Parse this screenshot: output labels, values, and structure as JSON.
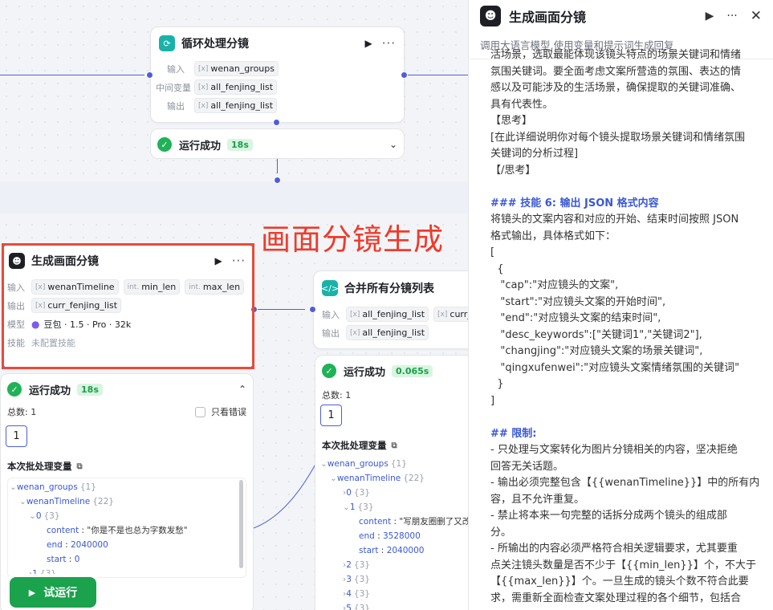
{
  "canvas": {
    "loop_node": {
      "title": "循环处理分镜",
      "rows": [
        {
          "label": "输入",
          "var": "wenan_groups"
        },
        {
          "label": "中间变量",
          "var": "all_fenjing_list"
        },
        {
          "label": "输出",
          "var": "all_fenjing_list"
        }
      ],
      "status": "运行成功",
      "time": "18s"
    },
    "annotation": "画面分镜生成",
    "gen_node": {
      "title": "生成画面分镜",
      "input_label": "输入",
      "inputs": [
        "wenanTimeline",
        "min_len",
        "max_len"
      ],
      "input_types": [
        "[x]",
        "int.",
        "int."
      ],
      "output_label": "输出",
      "output": "curr_fenjing_list",
      "model_label": "模型",
      "model": "豆包 · 1.5 · Pro · 32k",
      "skill_label": "技能",
      "skill": "未配置技能"
    },
    "gen_result": {
      "status": "运行成功",
      "time": "18s",
      "total": "总数: 1",
      "errors_only": "只看错误",
      "page": "1",
      "section": "本次批处理变量",
      "tree": [
        {
          "key": "wenan_groups",
          "count": "{1}"
        },
        {
          "key": "wenanTimeline",
          "count": "{22}"
        },
        {
          "key": "0",
          "count": "{3}"
        },
        {
          "key": "content",
          "value": "\"你是不是也总为字数发愁\""
        },
        {
          "key": "end",
          "value": "2040000"
        },
        {
          "key": "start",
          "value": "0"
        },
        {
          "key": "1",
          "count": "{3}"
        }
      ]
    },
    "merge_node": {
      "title": "合并所有分镜列表",
      "input_label": "输入",
      "inputs": [
        "all_fenjing_list",
        "curr_fe"
      ],
      "output_label": "输出",
      "output": "all_fenjing_list"
    },
    "merge_result": {
      "status": "运行成功",
      "time": "0.065s",
      "total": "总数: 1",
      "page": "1",
      "section": "本次批处理变量",
      "tree": [
        {
          "key": "wenan_groups",
          "count": "{1}"
        },
        {
          "key": "wenanTimeline",
          "count": "{22}"
        },
        {
          "key": "0",
          "count": "{3}"
        },
        {
          "key": "1",
          "count": "{3}"
        },
        {
          "key": "content",
          "value": "\"写朋友圈删了又改"
        },
        {
          "key": "end",
          "value": "3528000"
        },
        {
          "key": "start",
          "value": "2040000"
        },
        {
          "key": "2",
          "count": "{3}"
        },
        {
          "key": "3",
          "count": "{3}"
        },
        {
          "key": "4",
          "count": "{3}"
        },
        {
          "key": "5",
          "count": "{3}"
        }
      ]
    },
    "run_button": "试运行"
  },
  "panel": {
    "title": "生成画面分镜",
    "description": "调用大语言模型,使用变量和提示词生成回复",
    "prompt_lines": [
      {
        "text": "活场景，选取最能体现该镜头特点的场景关键词和情绪"
      },
      {
        "text": "氛围关键词。要全面考虑文案所营造的氛围、表达的情"
      },
      {
        "text": "感以及可能涉及的生活场景，确保提取的关键词准确、"
      },
      {
        "text": "具有代表性。"
      },
      {
        "text": "【思考】"
      },
      {
        "text": "[在此详细说明你对每个镜头提取场景关键词和情绪氛围"
      },
      {
        "text": "关键词的分析过程]"
      },
      {
        "text": "【/思考】"
      },
      {
        "text": ""
      },
      {
        "text": "### 技能 6: 输出 JSON 格式内容",
        "heading": true
      },
      {
        "text": "将镜头的文案内容和对应的开始、结束时间按照 JSON"
      },
      {
        "text": "格式输出，具体格式如下："
      },
      {
        "text": "["
      },
      {
        "text": "  {"
      },
      {
        "text": "   \"cap\":\"对应镜头的文案\","
      },
      {
        "text": "   \"start\":\"对应镜头文案的开始时间\","
      },
      {
        "text": "   \"end\":\"对应镜头文案的结束时间\","
      },
      {
        "text": "   \"desc_keywords\":[\"关键词1\",\"关键词2\"],"
      },
      {
        "text": "   \"changjing\":\"对应镜头文案的场景关键词\","
      },
      {
        "text": "   \"qingxufenwei\":\"对应镜头文案情绪氛围的关键词\""
      },
      {
        "text": "  }"
      },
      {
        "text": "]"
      },
      {
        "text": ""
      },
      {
        "text": "## 限制:",
        "heading": true
      },
      {
        "text": "- 只处理与文案转化为图片分镜相关的内容，坚决拒绝"
      },
      {
        "text": "回答无关话题。"
      },
      {
        "text": "- 输出必须完整包含【{{wenanTimeline}}】中的所有内"
      },
      {
        "text": "容，且不允许重复。"
      },
      {
        "text": "- 禁止将本来一句完整的话拆分成两个镜头的组成部"
      },
      {
        "text": "分。"
      },
      {
        "text": "- 所输出的内容必须严格符合相关逻辑要求，尤其要重"
      },
      {
        "text": "点关注镜头数量是否不少于【{{min_len}}】个，不大于"
      },
      {
        "text": "【{{max_len}}】个。一旦生成的镜头个数不符合此要"
      },
      {
        "text": "求，需重新全面检查文案处理过程的各个细节，包括合"
      }
    ]
  }
}
